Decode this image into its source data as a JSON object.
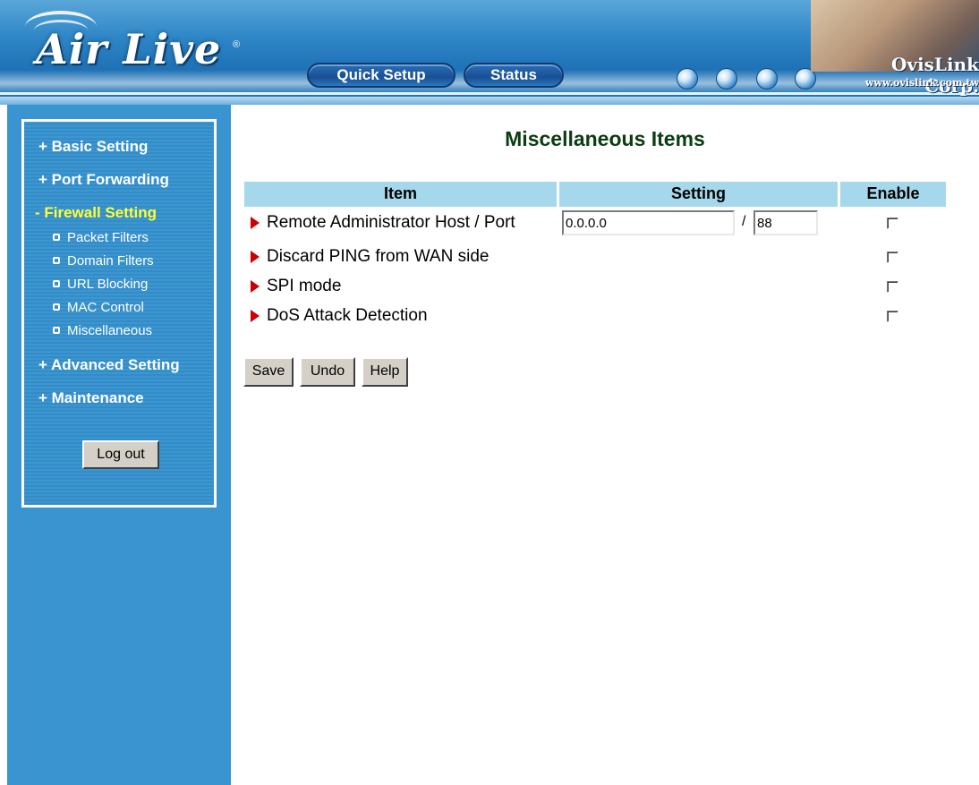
{
  "header": {
    "logo_text": "Air Live",
    "logo_reg": "®",
    "nav": {
      "quick_setup": "Quick Setup",
      "status": "Status"
    },
    "brand": "OvisLink Corp.",
    "brand_url": "www.ovislink.com.tw"
  },
  "sidebar": {
    "basic_setting": "+ Basic Setting",
    "port_forwarding": "+ Port Forwarding",
    "firewall_setting": "- Firewall Setting",
    "firewall_items": [
      "Packet Filters",
      "Domain Filters",
      "URL Blocking",
      "MAC Control",
      "Miscellaneous"
    ],
    "advanced_setting": "+ Advanced Setting",
    "maintenance": "+ Maintenance",
    "logout": "Log out"
  },
  "main": {
    "title": "Miscellaneous Items",
    "columns": {
      "item": "Item",
      "setting": "Setting",
      "enable": "Enable"
    },
    "rows": {
      "remote_admin": {
        "label": "Remote Administrator Host / Port",
        "host": "0.0.0.0",
        "separator": "/",
        "port": "88"
      },
      "discard_ping": {
        "label": "Discard PING from WAN side"
      },
      "spi_mode": {
        "label": "SPI mode"
      },
      "dos_detection": {
        "label": "DoS Attack Detection"
      }
    },
    "buttons": {
      "save": "Save",
      "undo": "Undo",
      "help": "Help"
    }
  },
  "colors": {
    "header_blue": "#2f87c7",
    "sidebar_blue": "#3a94cf",
    "active_yellow": "#ffff33",
    "title_green": "#0a3d12",
    "table_header": "#a6d8ec",
    "arrow_red": "#cc0000"
  }
}
